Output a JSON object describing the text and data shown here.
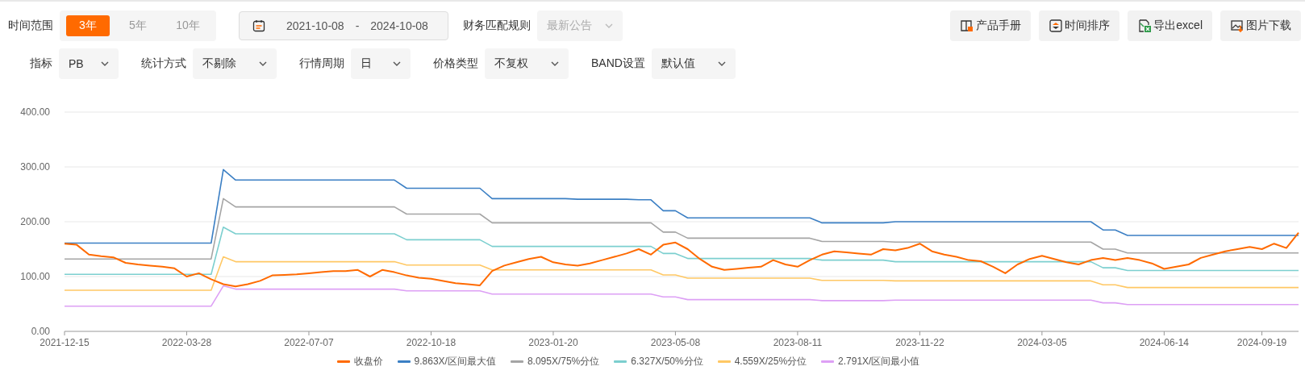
{
  "time_range": {
    "label": "时间范围",
    "options": [
      {
        "label": "3年",
        "selected": true
      },
      {
        "label": "5年",
        "selected": false
      },
      {
        "label": "10年",
        "selected": false
      }
    ]
  },
  "date_range": {
    "start": "2021-10-08",
    "separator": "-",
    "end": "2024-10-08"
  },
  "match_rule": {
    "label": "财务匹配规则",
    "value": "最新公告",
    "disabled": true
  },
  "toolbar": [
    {
      "label": "产品手册",
      "kind": "manual"
    },
    {
      "label": "时间排序",
      "kind": "sort"
    },
    {
      "label": "导出excel",
      "kind": "export"
    },
    {
      "label": "图片下载",
      "kind": "image"
    }
  ],
  "filters": [
    {
      "label": "指标",
      "value": "PB"
    },
    {
      "label": "统计方式",
      "value": "不剔除"
    },
    {
      "label": "行情周期",
      "value": "日"
    },
    {
      "label": "价格类型",
      "value": "不复权"
    },
    {
      "label": "BAND设置",
      "value": "默认值"
    }
  ],
  "chart": {
    "chart_data": {
      "type": "line",
      "grid": true,
      "ylim": [
        0,
        400
      ],
      "yticks": [
        {
          "value": 0,
          "label": "0.00"
        },
        {
          "value": 100,
          "label": "100.00"
        },
        {
          "value": 200,
          "label": "200.00"
        },
        {
          "value": 300,
          "label": "300.00"
        },
        {
          "value": 400,
          "label": "400.00"
        }
      ],
      "categories": [
        "2021-12-15",
        null,
        null,
        null,
        null,
        null,
        null,
        null,
        null,
        null,
        "2022-03-28",
        null,
        null,
        null,
        null,
        null,
        null,
        null,
        null,
        null,
        "2022-07-07",
        null,
        null,
        null,
        null,
        null,
        null,
        null,
        null,
        null,
        "2022-10-18",
        null,
        null,
        null,
        null,
        null,
        null,
        null,
        null,
        null,
        "2023-01-20",
        null,
        null,
        null,
        null,
        null,
        null,
        null,
        null,
        null,
        "2023-05-08",
        null,
        null,
        null,
        null,
        null,
        null,
        null,
        null,
        null,
        "2023-08-11",
        null,
        null,
        null,
        null,
        null,
        null,
        null,
        null,
        null,
        "2023-11-22",
        null,
        null,
        null,
        null,
        null,
        null,
        null,
        null,
        null,
        "2024-03-05",
        null,
        null,
        null,
        null,
        null,
        null,
        null,
        null,
        null,
        "2024-06-14",
        null,
        null,
        null,
        null,
        null,
        null,
        null,
        "2024-09-19",
        null,
        null,
        null
      ],
      "series": [
        {
          "name": "收盘价",
          "color": "#ff6a00",
          "values": [
            160,
            158,
            140,
            137,
            135,
            125,
            122,
            120,
            118,
            115,
            100,
            106,
            95,
            86,
            82,
            86,
            92,
            102,
            103,
            104,
            106,
            108,
            110,
            110,
            112,
            100,
            112,
            108,
            102,
            98,
            96,
            92,
            88,
            86,
            84,
            110,
            120,
            126,
            132,
            136,
            126,
            122,
            120,
            124,
            130,
            136,
            142,
            150,
            140,
            158,
            162,
            150,
            132,
            118,
            112,
            114,
            116,
            118,
            130,
            122,
            118,
            130,
            140,
            146,
            144,
            142,
            140,
            150,
            148,
            152,
            160,
            146,
            140,
            136,
            130,
            128,
            118,
            106,
            122,
            132,
            138,
            132,
            126,
            122,
            130,
            134,
            130,
            134,
            130,
            124,
            114,
            118,
            122,
            134,
            140,
            146,
            150,
            154,
            150,
            160,
            152,
            180
          ]
        },
        {
          "name": "9.863X/区间最大值",
          "color": "#3b7fc4",
          "values": [
            161,
            161,
            161,
            161,
            161,
            161,
            161,
            161,
            161,
            161,
            161,
            161,
            161,
            295,
            276,
            276,
            276,
            276,
            276,
            276,
            276,
            276,
            276,
            276,
            276,
            276,
            276,
            276,
            261,
            261,
            261,
            261,
            261,
            261,
            261,
            242,
            242,
            242,
            242,
            242,
            242,
            242,
            241,
            241,
            241,
            241,
            241,
            240,
            240,
            220,
            220,
            207,
            207,
            207,
            207,
            207,
            207,
            207,
            207,
            207,
            207,
            207,
            198,
            198,
            198,
            198,
            198,
            198,
            200,
            200,
            200,
            200,
            200,
            200,
            200,
            200,
            200,
            200,
            200,
            200,
            200,
            200,
            200,
            200,
            200,
            185,
            185,
            175,
            175,
            175,
            175,
            175,
            175,
            175,
            175,
            175,
            175,
            175,
            175,
            175,
            175,
            175
          ]
        },
        {
          "name": "8.095X/75%分位",
          "color": "#a5a5a5",
          "values": [
            132,
            132,
            132,
            132,
            132,
            132,
            132,
            132,
            132,
            132,
            132,
            132,
            132,
            242,
            227,
            227,
            227,
            227,
            227,
            227,
            227,
            227,
            227,
            227,
            227,
            227,
            227,
            227,
            214,
            214,
            214,
            214,
            214,
            214,
            214,
            198,
            198,
            198,
            198,
            198,
            198,
            198,
            198,
            198,
            198,
            198,
            198,
            198,
            198,
            181,
            181,
            170,
            170,
            170,
            170,
            170,
            170,
            170,
            170,
            170,
            170,
            170,
            164,
            164,
            164,
            164,
            164,
            164,
            163,
            163,
            163,
            163,
            163,
            163,
            163,
            163,
            163,
            163,
            163,
            163,
            163,
            163,
            163,
            163,
            163,
            150,
            150,
            143,
            143,
            143,
            143,
            143,
            143,
            143,
            143,
            143,
            143,
            143,
            143,
            143,
            143,
            143
          ]
        },
        {
          "name": "6.327X/50%分位",
          "color": "#7ccfcf",
          "values": [
            104,
            104,
            104,
            104,
            104,
            104,
            104,
            104,
            104,
            104,
            104,
            104,
            104,
            190,
            178,
            178,
            178,
            178,
            178,
            178,
            178,
            178,
            178,
            178,
            178,
            178,
            178,
            178,
            167,
            167,
            167,
            167,
            167,
            167,
            167,
            155,
            155,
            155,
            155,
            155,
            155,
            155,
            155,
            155,
            155,
            155,
            155,
            155,
            155,
            142,
            142,
            133,
            133,
            133,
            133,
            133,
            133,
            133,
            133,
            133,
            133,
            133,
            130,
            130,
            130,
            130,
            130,
            130,
            127,
            127,
            127,
            127,
            127,
            127,
            127,
            127,
            127,
            127,
            127,
            127,
            127,
            127,
            127,
            127,
            127,
            116,
            116,
            111,
            111,
            111,
            111,
            111,
            111,
            111,
            111,
            111,
            111,
            111,
            111,
            111,
            111,
            111
          ]
        },
        {
          "name": "4.559X/25%分位",
          "color": "#ffc864",
          "values": [
            75,
            75,
            75,
            75,
            75,
            75,
            75,
            75,
            75,
            75,
            75,
            75,
            75,
            136,
            127,
            127,
            127,
            127,
            127,
            127,
            127,
            127,
            127,
            127,
            127,
            127,
            127,
            127,
            121,
            121,
            121,
            121,
            121,
            121,
            121,
            112,
            112,
            112,
            112,
            112,
            112,
            112,
            112,
            112,
            112,
            112,
            112,
            112,
            112,
            103,
            103,
            97,
            97,
            97,
            97,
            97,
            97,
            97,
            97,
            97,
            97,
            97,
            93,
            93,
            93,
            93,
            93,
            93,
            92,
            92,
            92,
            92,
            92,
            92,
            92,
            92,
            92,
            92,
            92,
            92,
            92,
            92,
            92,
            92,
            92,
            85,
            85,
            80,
            80,
            80,
            80,
            80,
            80,
            80,
            80,
            80,
            80,
            80,
            80,
            80,
            80,
            80
          ]
        },
        {
          "name": "2.791X/区间最小值",
          "color": "#dda0f5",
          "values": [
            46,
            46,
            46,
            46,
            46,
            46,
            46,
            46,
            46,
            46,
            46,
            46,
            46,
            83,
            77,
            77,
            77,
            77,
            77,
            77,
            77,
            77,
            77,
            77,
            77,
            77,
            77,
            77,
            74,
            74,
            74,
            74,
            74,
            74,
            74,
            68,
            68,
            68,
            68,
            68,
            68,
            68,
            68,
            68,
            68,
            68,
            68,
            68,
            68,
            63,
            63,
            58,
            58,
            58,
            58,
            58,
            58,
            58,
            58,
            58,
            58,
            58,
            56,
            56,
            56,
            56,
            56,
            56,
            57,
            57,
            57,
            57,
            57,
            57,
            57,
            57,
            57,
            57,
            57,
            57,
            57,
            57,
            57,
            57,
            57,
            52,
            52,
            49,
            49,
            49,
            49,
            49,
            49,
            49,
            49,
            49,
            49,
            49,
            49,
            49,
            49,
            49
          ]
        }
      ]
    }
  }
}
